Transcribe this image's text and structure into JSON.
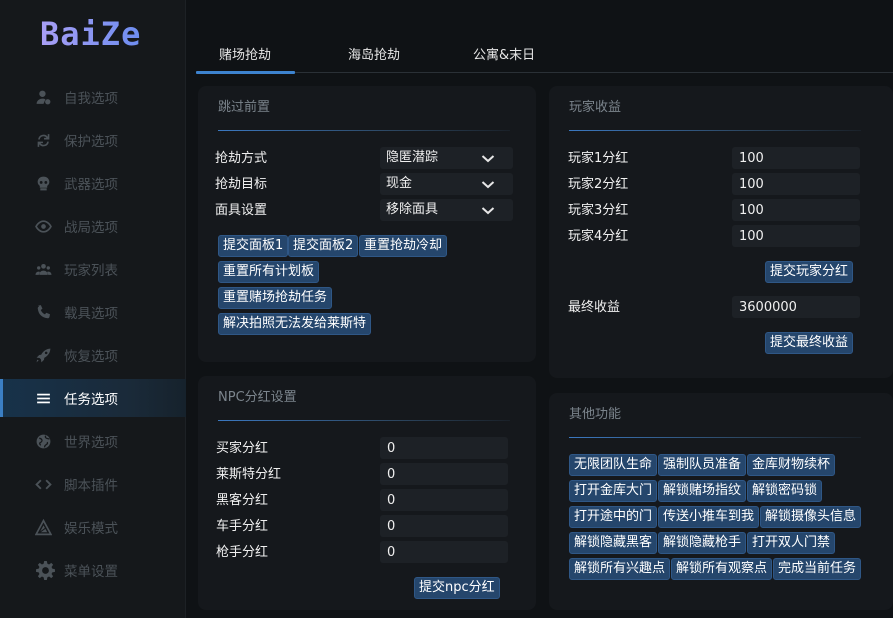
{
  "app": {
    "logo": "BaiZe"
  },
  "sidebar": {
    "items": [
      {
        "label": "自我选项",
        "icon": "person-icon"
      },
      {
        "label": "保护选项",
        "icon": "refresh-icon"
      },
      {
        "label": "武器选项",
        "icon": "skull-icon"
      },
      {
        "label": "战局选项",
        "icon": "eye-icon"
      },
      {
        "label": "玩家列表",
        "icon": "group-icon"
      },
      {
        "label": "载具选项",
        "icon": "phone-icon"
      },
      {
        "label": "恢复选项",
        "icon": "rocket-icon"
      },
      {
        "label": "任务选项",
        "icon": "menu-icon",
        "active": true
      },
      {
        "label": "世界选项",
        "icon": "globe-icon"
      },
      {
        "label": "脚本插件",
        "icon": "code-icon"
      },
      {
        "label": "娱乐模式",
        "icon": "triangle-icon"
      },
      {
        "label": "菜单设置",
        "icon": "gear-icon"
      }
    ]
  },
  "tabs": [
    {
      "label": "赌场抢劫",
      "active": true
    },
    {
      "label": "海岛抢劫"
    },
    {
      "label": "公寓&末日"
    }
  ],
  "skip_setup": {
    "title": "跳过前置",
    "rows": [
      {
        "label": "抢劫方式",
        "value": "隐匿潜踪"
      },
      {
        "label": "抢劫目标",
        "value": "现金"
      },
      {
        "label": "面具设置",
        "value": "移除面具"
      }
    ],
    "buttons": {
      "submit_board1": "提交面板1",
      "submit_board2": "提交面板2",
      "reset_cooldown": "重置抢劫冷却",
      "reset_all_boards": "重置所有计划板",
      "reset_casino_mission": "重置赌场抢劫任务",
      "fix_photo": "解决拍照无法发给莱斯特"
    }
  },
  "npc_cut": {
    "title": "NPC分红设置",
    "rows": [
      {
        "label": "买家分红",
        "value": "0"
      },
      {
        "label": "莱斯特分红",
        "value": "0"
      },
      {
        "label": "黑客分红",
        "value": "0"
      },
      {
        "label": "车手分红",
        "value": "0"
      },
      {
        "label": "枪手分红",
        "value": "0"
      }
    ],
    "submit": "提交npc分红"
  },
  "player_earnings": {
    "title": "玩家收益",
    "rows": [
      {
        "label": "玩家1分红",
        "value": "100"
      },
      {
        "label": "玩家2分红",
        "value": "100"
      },
      {
        "label": "玩家3分红",
        "value": "100"
      },
      {
        "label": "玩家4分红",
        "value": "100"
      }
    ],
    "submit_players": "提交玩家分红",
    "final_label": "最终收益",
    "final_value": "3600000",
    "submit_final": "提交最终收益"
  },
  "other": {
    "title": "其他功能",
    "buttons": [
      [
        "无限团队生命",
        "强制队员准备",
        "金库财物续杯"
      ],
      [
        "打开金库大门",
        "解锁赌场指纹",
        "解锁密码锁"
      ],
      [
        "打开途中的门",
        "传送小推车到我",
        "解锁摄像头信息"
      ],
      [
        "解锁隐藏黑客",
        "解锁隐藏枪手",
        "打开双人门禁"
      ],
      [
        "解锁所有兴趣点",
        "解锁所有观察点",
        "完成当前任务"
      ]
    ]
  },
  "colors": {
    "accent": "#3d83cf",
    "button": "#25466c",
    "panel": "#15181c"
  }
}
